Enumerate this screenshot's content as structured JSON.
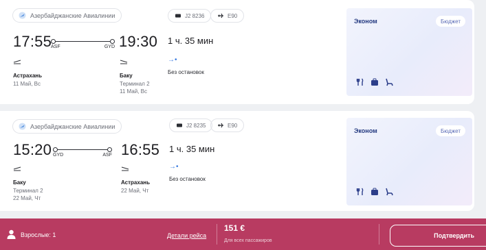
{
  "colors": {
    "footer_bg": "#b83b61",
    "fare_title": "#243a80",
    "accent_blue": "#3a7be0"
  },
  "flights": [
    {
      "airline": "Азербайджанские Авиалинии",
      "flight_no": "J2 8236",
      "aircraft": "E90",
      "dep_time": "17:55",
      "arr_time": "19:30",
      "dep_code": "ASF",
      "arr_code": "GYD",
      "duration": "1 ч. 35 мин",
      "stops": "Без остановок",
      "dep_city": "Астрахань",
      "dep_date": "11 Май, Вс",
      "arr_city": "Баку",
      "arr_terminal": "Терминал 2",
      "arr_date": "11 Май, Вс",
      "fare_class": "Эконом",
      "fare_badge": "Бюджет"
    },
    {
      "airline": "Азербайджанские Авиалинии",
      "flight_no": "J2 8235",
      "aircraft": "E90",
      "dep_time": "15:20",
      "arr_time": "16:55",
      "dep_code": "GYD",
      "arr_code": "ASF",
      "duration": "1 ч. 35 мин",
      "stops": "Без остановок",
      "dep_city": "Баку",
      "dep_terminal": "Терминал 2",
      "dep_date": "22 Май, Чт",
      "arr_city": "Астрахань",
      "arr_date": "22 Май, Чт",
      "fare_class": "Эконом",
      "fare_badge": "Бюджет"
    }
  ],
  "footer": {
    "passengers": "Взрослые: 1",
    "details_link": "Детали рейса",
    "price": "151 €",
    "price_note": "Для всех пассажиров",
    "confirm": "Подтвердить"
  }
}
